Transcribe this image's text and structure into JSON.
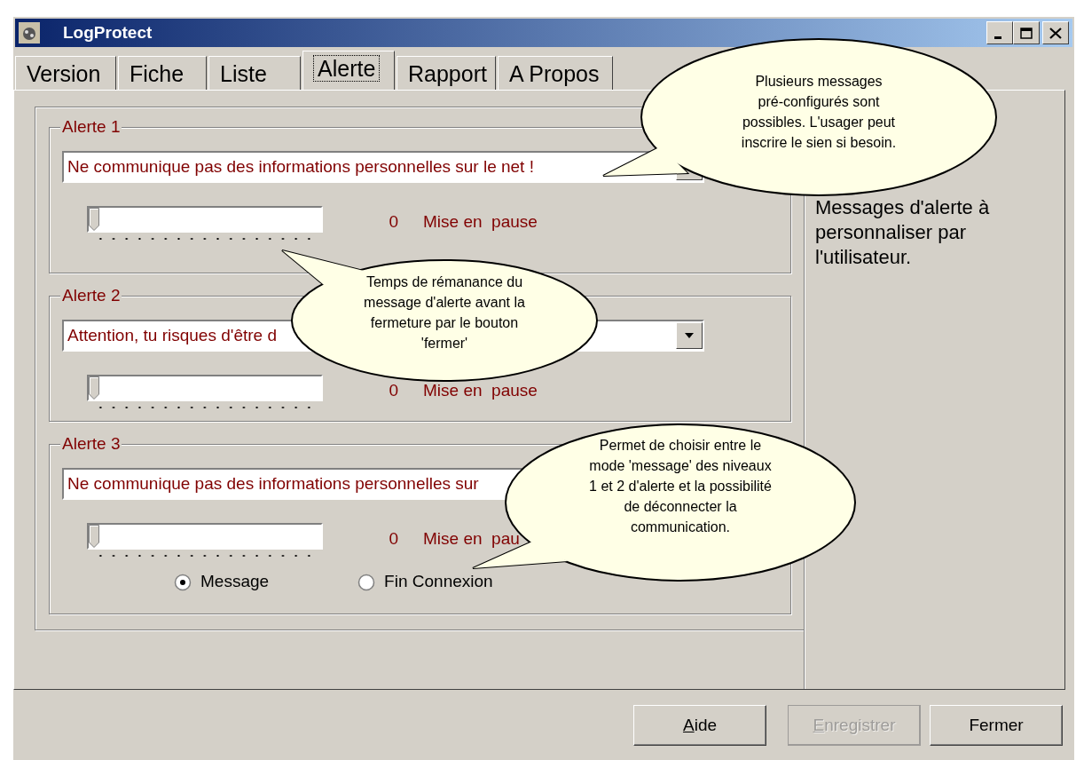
{
  "window": {
    "title": "LogProtect"
  },
  "tabs": [
    {
      "label": "Version",
      "selected": false
    },
    {
      "label": "Fiche",
      "selected": false
    },
    {
      "label": "Liste",
      "selected": false
    },
    {
      "label": "Alerte",
      "selected": true
    },
    {
      "label": "Rapport",
      "selected": false
    },
    {
      "label": "A Propos",
      "selected": false
    }
  ],
  "alerts": [
    {
      "title": "Alerte 1",
      "message": "Ne communique pas des informations personnelles sur le net !",
      "level": 0,
      "reading": "0",
      "status": "Mise en  pause",
      "dropdown_button": true
    },
    {
      "title": "Alerte 2",
      "message": "Attention, tu risques d'être d",
      "level": 0,
      "reading": "0",
      "status": "Mise en  pause",
      "dropdown_button": true
    },
    {
      "title": "Alerte 3",
      "message": "Ne communique pas des informations personnelles sur",
      "level": 0,
      "reading": "0",
      "status": "Mise en  pau",
      "dropdown_button": false,
      "modes": [
        {
          "label": "Message",
          "selected": true
        },
        {
          "label": "Fin Connexion",
          "selected": false
        }
      ]
    }
  ],
  "side_note": "Messages d'alerte à personnaliser par l'utilisateur.",
  "callouts": [
    {
      "lines": [
        "Plusieurs messages",
        "pré-configurés sont",
        "possibles. L'usager peut",
        "inscrire le sien si besoin."
      ]
    },
    {
      "lines": [
        "Temps de rémanance du",
        "message d'alerte avant la",
        "fermeture par le bouton",
        "'fermer'"
      ]
    },
    {
      "lines": [
        "Permet de choisir entre le",
        "mode 'message' des niveaux",
        "1 et 2 d'alerte et la possibilité",
        "de déconnecter la",
        "communication."
      ]
    }
  ],
  "buttons": [
    {
      "label": "Aide",
      "disabled": false,
      "mnemonic": true
    },
    {
      "label": "Enregistrer",
      "disabled": true,
      "mnemonic": true
    },
    {
      "label": "Fermer",
      "disabled": false,
      "mnemonic": false
    }
  ]
}
